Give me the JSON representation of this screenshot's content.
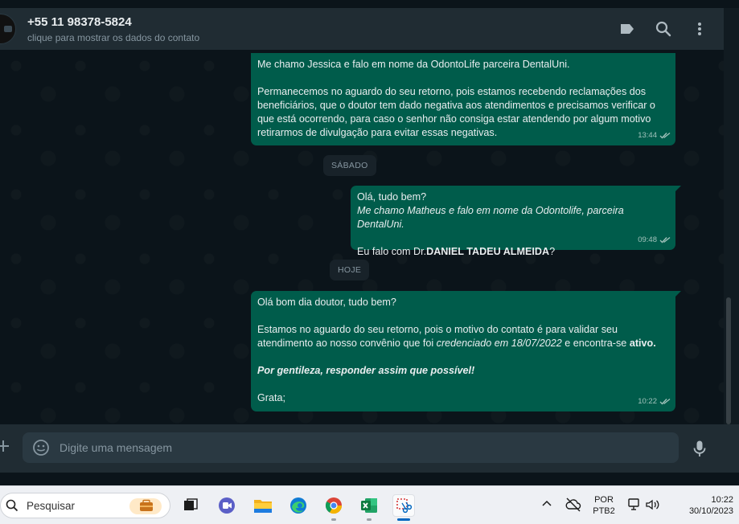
{
  "header": {
    "contact_name": "+55 11 98378-5824",
    "contact_subtitle": "clique para mostrar os dados do contato"
  },
  "messages": [
    {
      "lines": [
        "Me chamo Jessica e falo em nome da OdontoLife parceira DentalUni.",
        "",
        "Permanecemos no aguardo do seu retorno, pois estamos recebendo reclamações dos",
        "beneficiários, que o doutor tem dado negativa aos atendimentos e precisamos verificar o",
        "que está ocorrendo, para caso o senhor não consiga estar atendendo por algum motivo",
        "retirarmos de divulgação para evitar essas negativas."
      ],
      "time": "13:44"
    },
    {
      "line1": "Olá, tudo bem?",
      "line2_italic": "Me chamo Matheus e falo em nome da Odontolife, parceira DentalUni.",
      "line3_prefix": "Eu falo com Dr.",
      "line3_bold": "DANIEL TADEU ALMEIDA",
      "line3_suffix": "?",
      "time": "09:48"
    },
    {
      "line1": "Olá bom dia doutor, tudo bem?",
      "line2": "Estamos no aguardo do seu retorno, pois o motivo do contato é para validar seu",
      "line3_prefix": "atendimento ao nosso convênio que foi ",
      "line3_italic": "credenciado em 18/07/2022",
      "line3_middle": " e encontra-se ",
      "line3_bold": "ativo.",
      "line4_bold_italic": "Por gentileza, responder assim que possível!",
      "line5": "Grata;",
      "time": "10:22"
    }
  ],
  "day_dividers": [
    "SÁBADO",
    "HOJE"
  ],
  "composer": {
    "placeholder": "Digite uma mensagem"
  },
  "taskbar": {
    "search_label": "Pesquisar",
    "language_line1": "POR",
    "language_line2": "PTB2",
    "clock_time": "10:22",
    "clock_date": "30/10/2023"
  },
  "colors": {
    "outgoing_bubble": "#005c4b",
    "chat_background": "#0b141a",
    "header": "#202c33"
  }
}
